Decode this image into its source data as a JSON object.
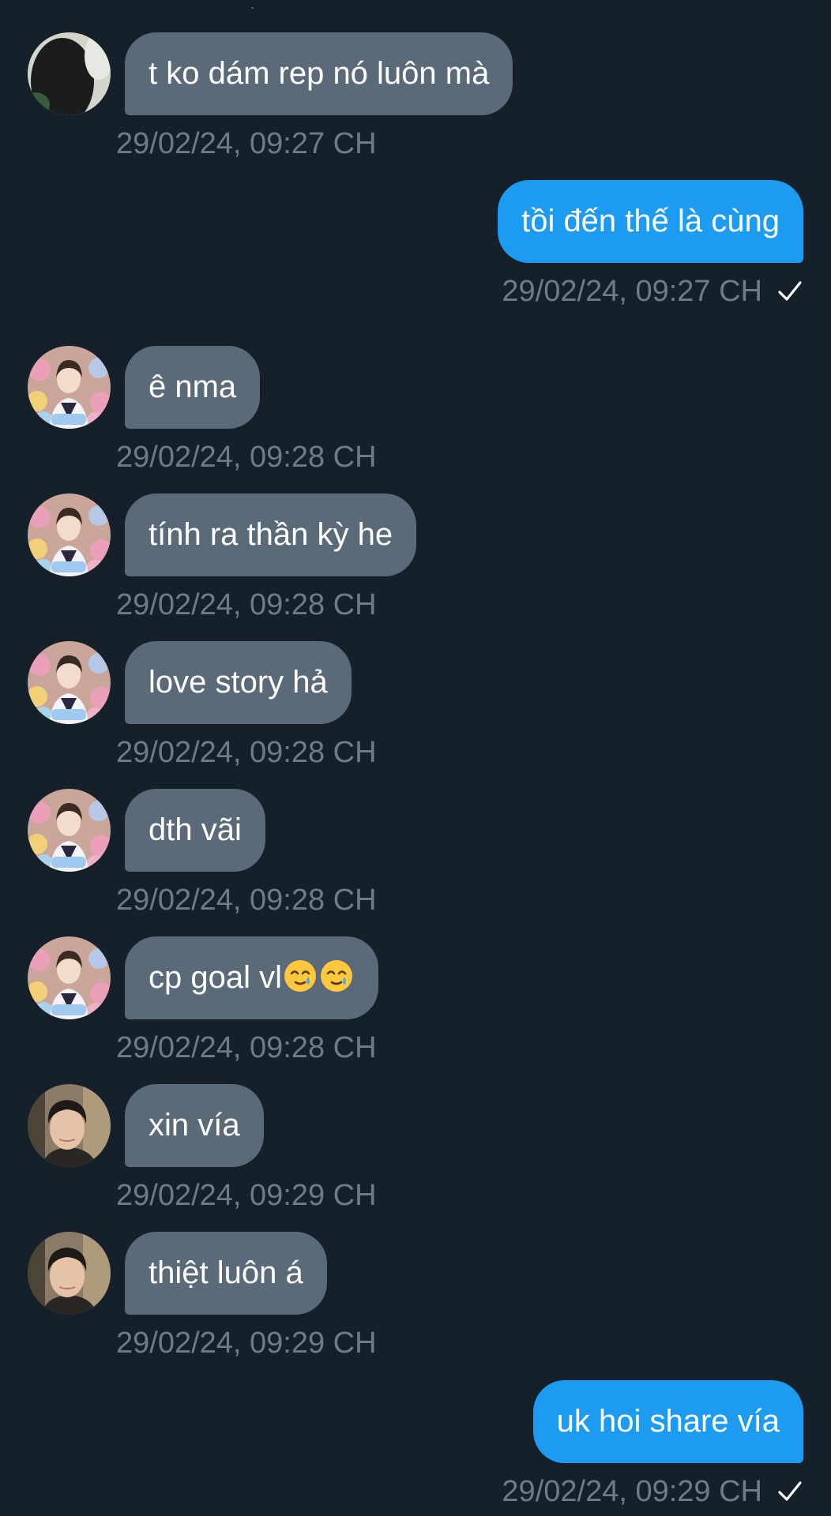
{
  "messages": [
    {
      "direction": "in",
      "avatar": "dark-photo-avatar",
      "text": "t ko dám rep nó luôn mà",
      "timestamp": "29/02/24, 09:27 CH"
    },
    {
      "direction": "out",
      "text": "tồi đến thế là cùng",
      "timestamp": "29/02/24, 09:27 CH",
      "status_icon": "check-icon"
    },
    {
      "direction": "in",
      "avatar": "boy-plush-avatar",
      "text": "ê nma",
      "timestamp": "29/02/24, 09:28 CH"
    },
    {
      "direction": "in",
      "avatar": "boy-plush-avatar",
      "text": "tính ra thần kỳ he",
      "timestamp": "29/02/24, 09:28 CH"
    },
    {
      "direction": "in",
      "avatar": "boy-plush-avatar",
      "text": "love story hả",
      "timestamp": "29/02/24, 09:28 CH"
    },
    {
      "direction": "in",
      "avatar": "boy-plush-avatar",
      "text": "dth vãi",
      "timestamp": "29/02/24, 09:28 CH"
    },
    {
      "direction": "in",
      "avatar": "boy-plush-avatar",
      "text": "cp goal vl",
      "emojis": [
        "smiling-face-with-tear-emoji",
        "smiling-face-with-tear-emoji"
      ],
      "timestamp": "29/02/24, 09:28 CH"
    },
    {
      "direction": "in",
      "avatar": "selfie-avatar",
      "text": "xin vía",
      "timestamp": "29/02/24, 09:29 CH"
    },
    {
      "direction": "in",
      "avatar": "selfie-avatar",
      "text": "thiệt luôn á",
      "timestamp": "29/02/24, 09:29 CH"
    },
    {
      "direction": "out",
      "text": "uk hoi share vía",
      "timestamp": "29/02/24, 09:29 CH",
      "status_icon": "check-icon"
    }
  ],
  "colors": {
    "background": "#15202b",
    "incoming_bubble": "#5b6a78",
    "outgoing_bubble": "#1d9bf0",
    "timestamp": "#6e7c8a"
  }
}
